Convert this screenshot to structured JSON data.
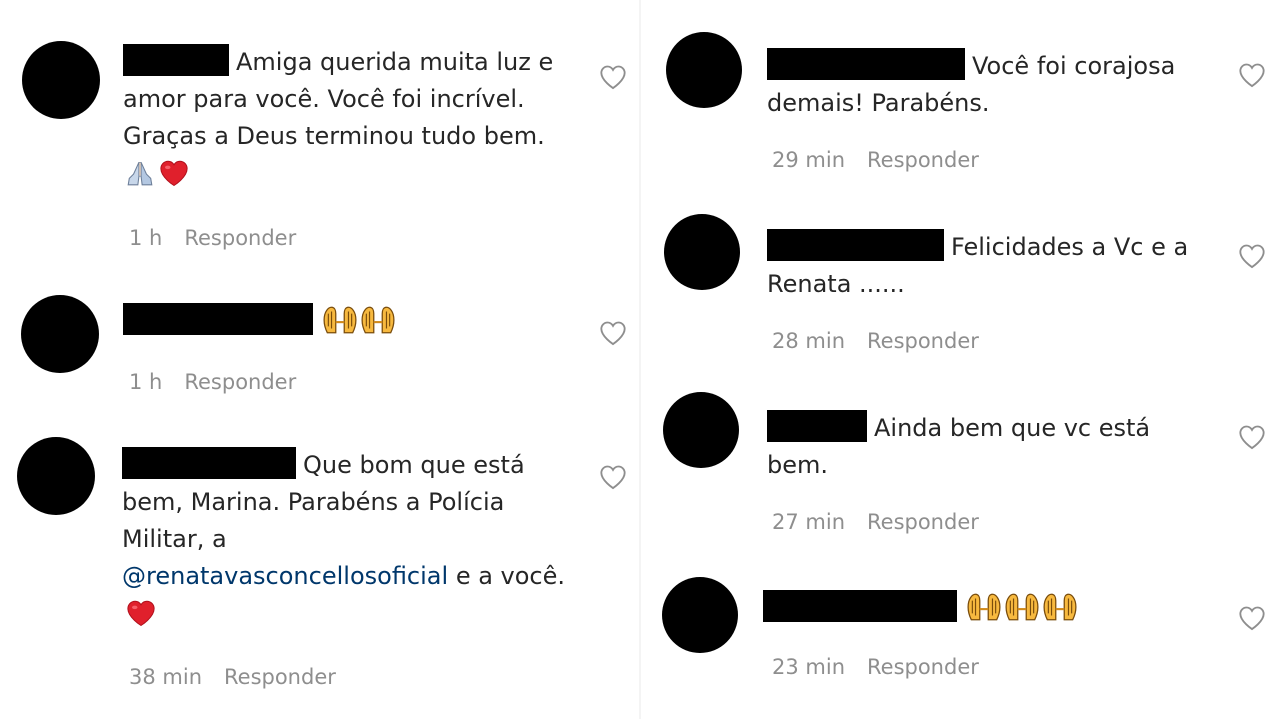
{
  "left_comments": [
    {
      "text": "Amiga querida muita luz e amor para você. Você foi incrível. Graças a Deus terminou tudo bem.",
      "time": "1 h",
      "reply_label": "Responder"
    },
    {
      "text": "",
      "time": "1 h",
      "reply_label": "Responder"
    },
    {
      "text_before": "Que bom que está bem, Marina. Parabéns a Polícia Militar, a",
      "mention": "@renatavasconcellosoficial",
      "text_after": "e a você.",
      "time": "38 min",
      "reply_label": "Responder"
    }
  ],
  "right_comments": [
    {
      "text": "Você foi corajosa demais! Parabéns.",
      "time": "29 min",
      "reply_label": "Responder"
    },
    {
      "text": "Felicidades a Vc e a Renata ......",
      "time": "28 min",
      "reply_label": "Responder"
    },
    {
      "text": "Ainda bem que vc está bem.",
      "time": "27 min",
      "reply_label": "Responder"
    },
    {
      "text": "",
      "time": "23 min",
      "reply_label": "Responder"
    }
  ],
  "icons": {
    "like": "heart-outline-icon",
    "red_heart": "red-heart-emoji",
    "praying_hands": "praying-hands-emoji",
    "high_five": "raised-hands-emoji"
  },
  "colors": {
    "text": "#262626",
    "meta": "#8e8e8e",
    "mention": "#00376b",
    "heart_red": "#e0202c"
  }
}
